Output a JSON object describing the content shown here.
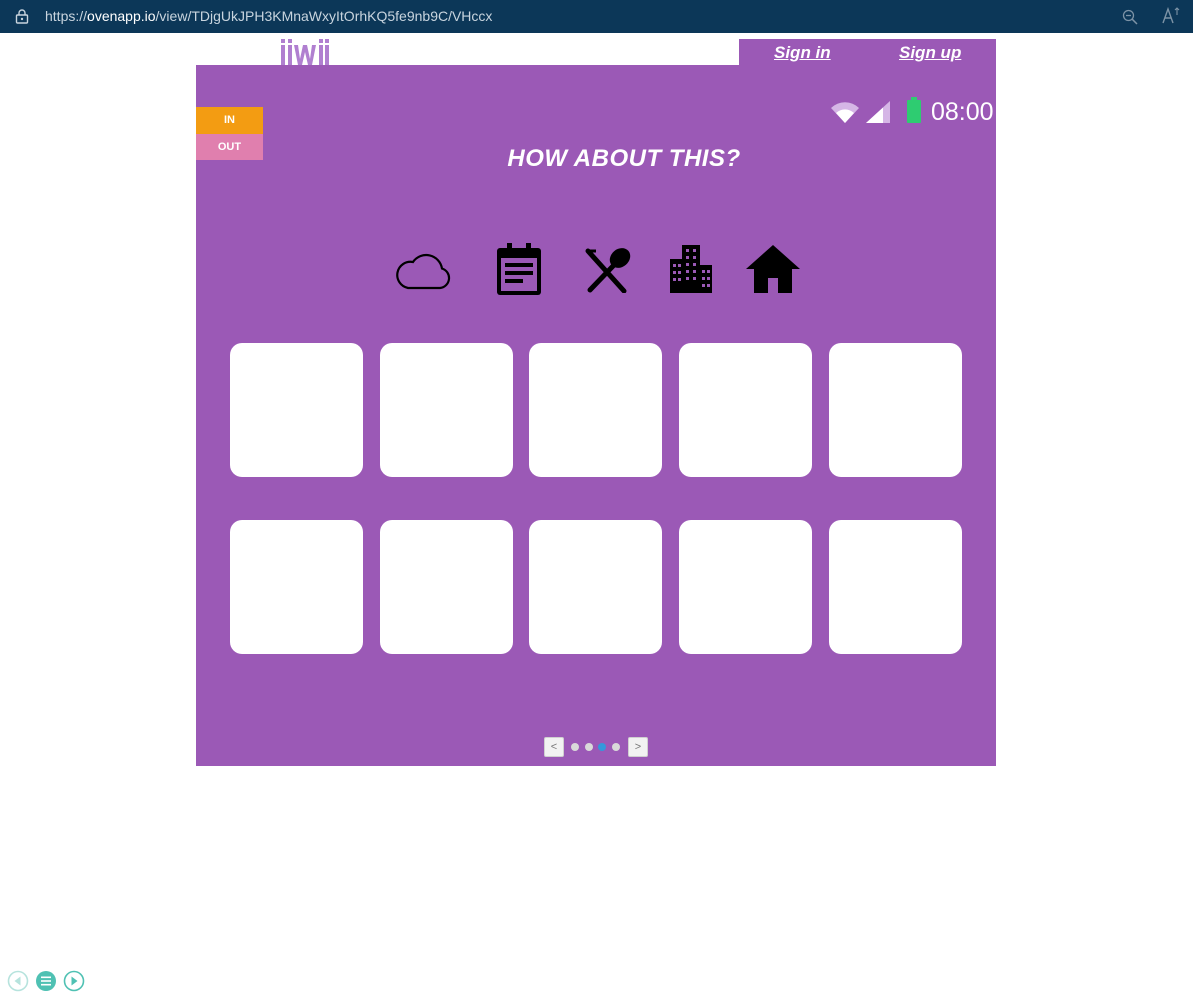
{
  "browser": {
    "url_prefix": "https://",
    "url_host": "ovenapp.io",
    "url_path": "/view/TDjgUkJPH3KMnaWxyItOrhKQ5fe9nb9C/VHccx"
  },
  "header": {
    "logo_text": "iiwii",
    "sign_in": "Sign in",
    "sign_up": "Sign up"
  },
  "mode": {
    "in_label": "IN",
    "out_label": "OUT"
  },
  "status_bar": {
    "time": "08:00",
    "battery_color": "#2ecc71"
  },
  "screen": {
    "title": "HOW ABOUT THIS?",
    "background": "#9b59b6",
    "categories": [
      "cloud-icon",
      "calendar-icon",
      "dining-icon",
      "city-icon",
      "home-icon"
    ],
    "tiles_count": 10
  },
  "pager": {
    "prev_label": "<",
    "next_label": ">",
    "pages": 4,
    "active_page": 3
  }
}
